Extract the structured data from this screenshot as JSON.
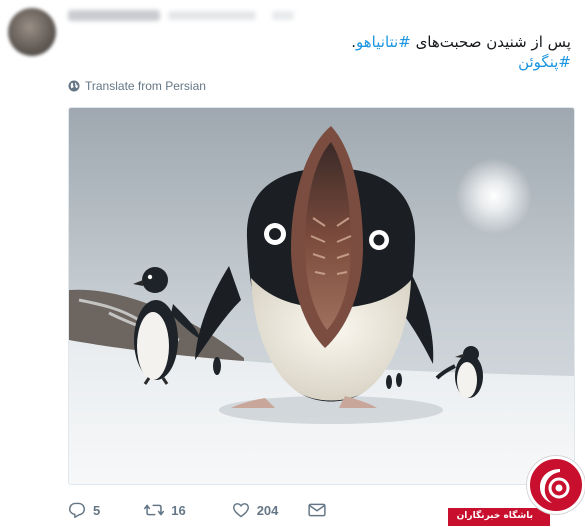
{
  "tweet": {
    "text": {
      "prefix": "پس از شنیدن صحبت‌های ",
      "hashtag_1": "#نتانیاهو",
      "suffix": ".",
      "hashtag_2": "#پنگوئن"
    },
    "translate_label": "Translate from Persian"
  },
  "actions": {
    "reply_count": "5",
    "retweet_count": "16",
    "like_count": "204"
  },
  "watermark": {
    "text": "باشگاه خبرنگاران"
  },
  "colors": {
    "link": "#1b95e0",
    "muted": "#657786",
    "watermark_red": "#c8102e"
  },
  "icons": [
    "globe-icon",
    "reply-icon",
    "retweet-icon",
    "like-icon",
    "message-icon",
    "camera-logo-icon"
  ]
}
